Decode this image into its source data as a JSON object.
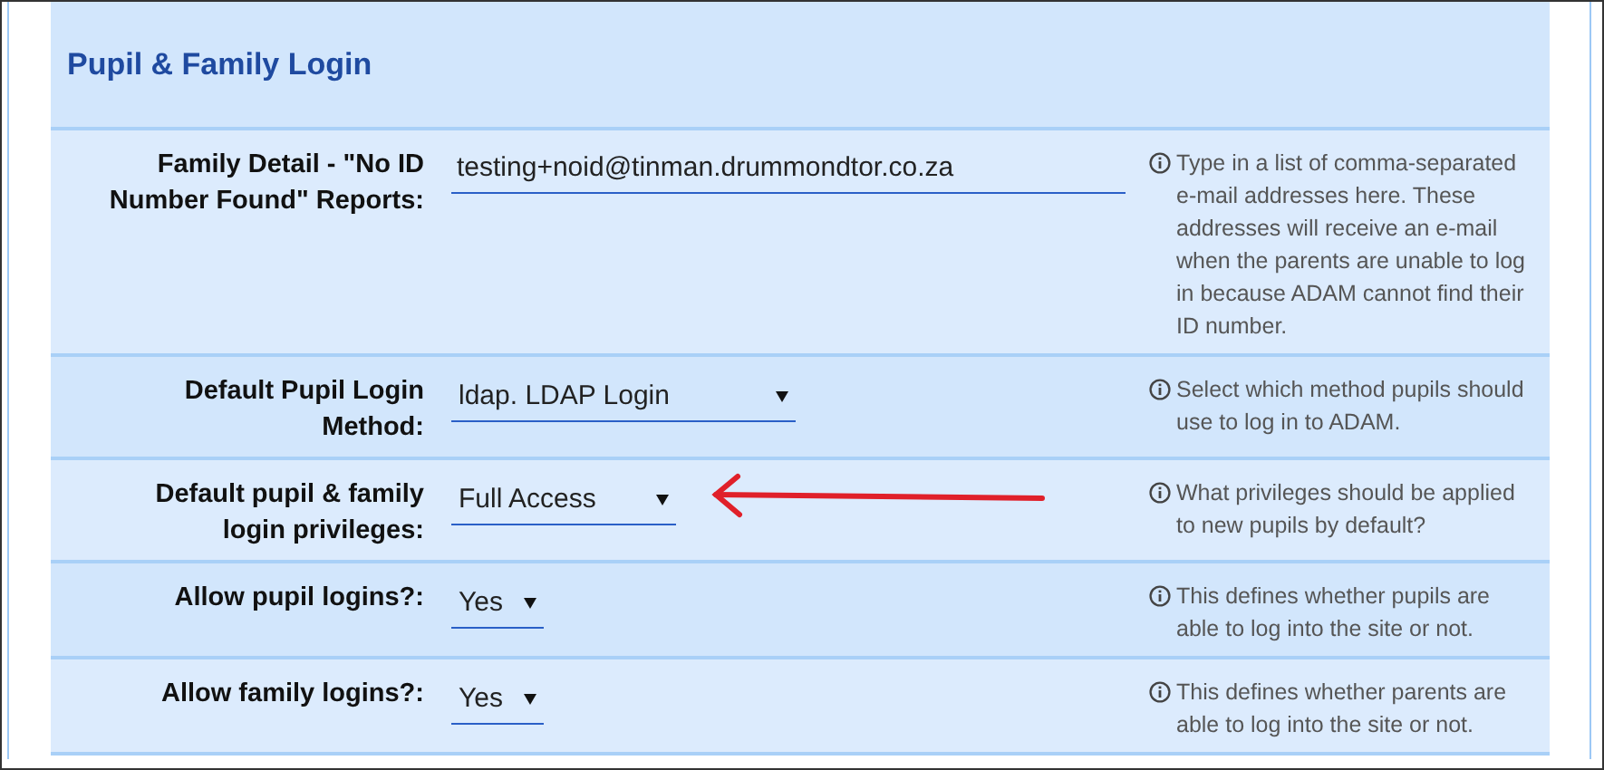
{
  "section": {
    "title": "Pupil & Family Login"
  },
  "rows": [
    {
      "kind": "text",
      "label": "Family Detail - \"No ID Number Found\" Reports:",
      "value": "testing+noid@tinman.drummondtor.co.za",
      "help": "Type in a list of comma-separated e-mail addresses here. These addresses will receive an e-mail when the parents are unable to log in because ADAM cannot find their ID number."
    },
    {
      "kind": "select",
      "label": "Default Pupil Login Method:",
      "value": "ldap. LDAP Login",
      "help": "Select which method pupils should use to log in to ADAM."
    },
    {
      "kind": "select",
      "label": "Default pupil & family login privileges:",
      "value": "Full Access",
      "help": "What privileges should be applied to new pupils by default?",
      "annotated": true
    },
    {
      "kind": "select",
      "label": "Allow pupil logins?:",
      "value": "Yes",
      "help": "This defines whether pupils are able to log into the site or not."
    },
    {
      "kind": "select",
      "label": "Allow family logins?:",
      "value": "Yes",
      "help": "This defines whether parents are able to log into the site or not."
    }
  ]
}
